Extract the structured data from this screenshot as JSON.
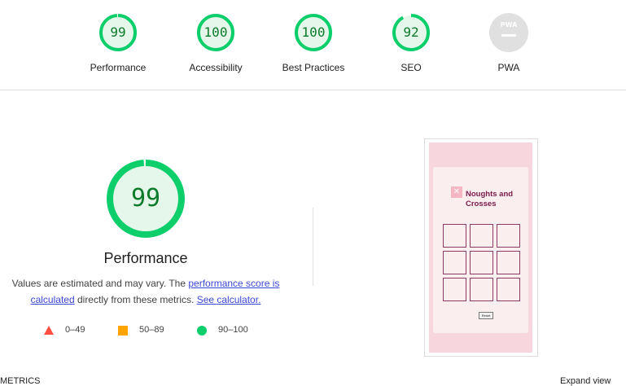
{
  "top_scores": [
    {
      "label": "Performance",
      "score": "99",
      "score_value": 99,
      "color": "#0cce6b"
    },
    {
      "label": "Accessibility",
      "score": "100",
      "score_value": 100,
      "color": "#0cce6b"
    },
    {
      "label": "Best Practices",
      "score": "100",
      "score_value": 100,
      "color": "#0cce6b"
    },
    {
      "label": "SEO",
      "score": "92",
      "score_value": 92,
      "color": "#0cce6b"
    },
    {
      "label": "PWA",
      "badge_text": "PWA",
      "color": "#cccccc"
    }
  ],
  "main": {
    "score": "99",
    "score_value": 99,
    "title": "Performance",
    "description_parts": {
      "text1": "Values are estimated and may vary. The ",
      "link1": "performance score is calculated",
      "text2": " directly from these metrics. ",
      "link2": "See calculator."
    }
  },
  "legend": [
    {
      "shape": "triangle",
      "range": "0–49",
      "color": "#ff4e42"
    },
    {
      "shape": "square",
      "range": "50–89",
      "color": "#ffa400"
    },
    {
      "shape": "circle",
      "range": "90–100",
      "color": "#0cce6b"
    }
  ],
  "screenshot": {
    "app_title": "Noughts and Crosses",
    "reset_label": "Reset",
    "icon": "x-icon"
  },
  "bottom": {
    "left_text": "METRICS",
    "right_text": "Expand view"
  },
  "colors": {
    "pass_green": "#0cce6b",
    "pass_text": "#0b7a2a",
    "gauge_bg": "#e5f7ea",
    "link": "#3b47d6"
  }
}
